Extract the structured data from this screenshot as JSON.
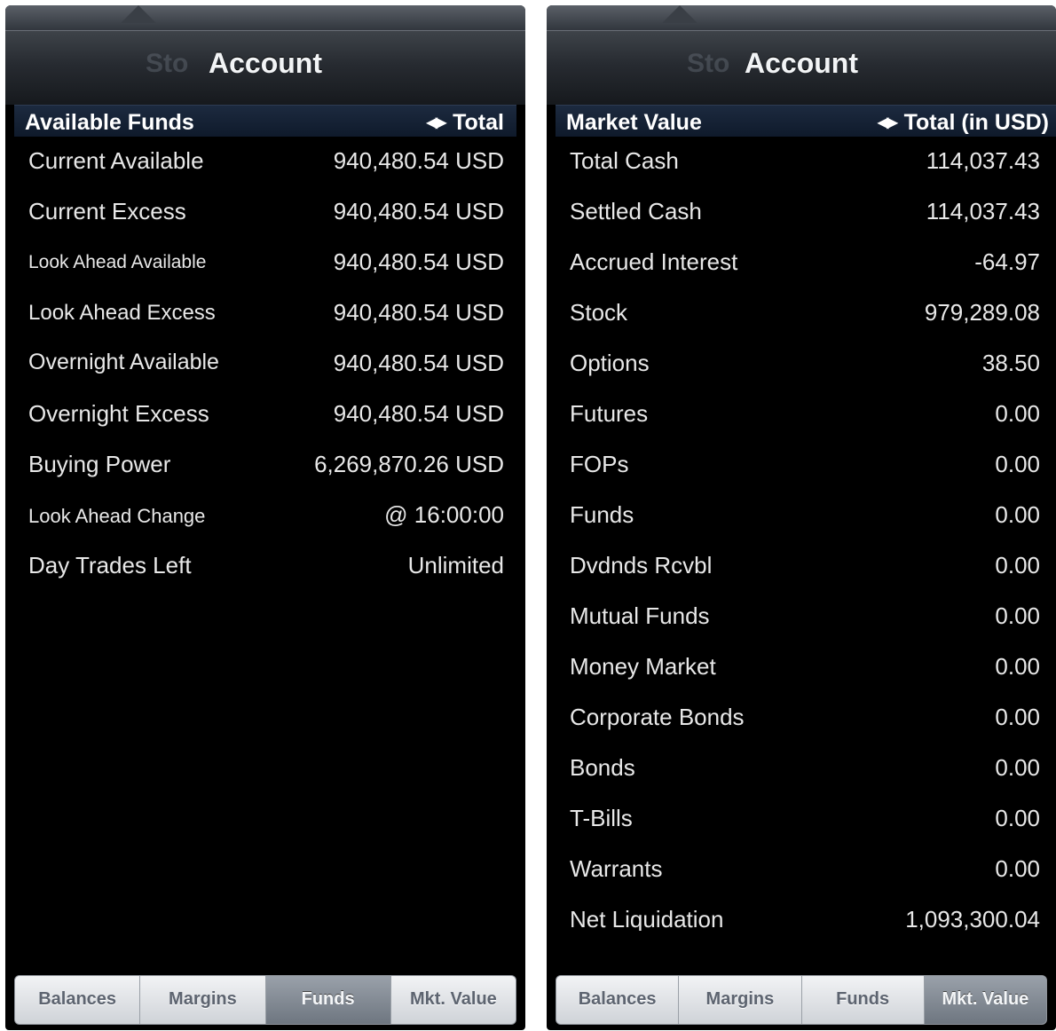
{
  "left": {
    "title": "Account",
    "ghost": "Sto",
    "section": {
      "title": "Available Funds",
      "arrows": "◀▶",
      "right_label": "Total"
    },
    "rows": [
      {
        "label": "Current Available",
        "value": "940,480.54 USD"
      },
      {
        "label": "Current Excess",
        "value": "940,480.54 USD"
      },
      {
        "label": "Look Ahead Available",
        "value": "940,480.54 USD"
      },
      {
        "label": "Look Ahead Excess",
        "value": "940,480.54 USD"
      },
      {
        "label": "Overnight Available",
        "value": "940,480.54 USD"
      },
      {
        "label": "Overnight Excess",
        "value": "940,480.54 USD"
      },
      {
        "label": "Buying Power",
        "value": "6,269,870.26 USD"
      },
      {
        "label": "Look Ahead Change",
        "value": "@ 16:00:00"
      },
      {
        "label": "Day Trades Left",
        "value": "Unlimited"
      }
    ],
    "tabs": [
      "Balances",
      "Margins",
      "Funds",
      "Mkt. Value"
    ],
    "active_tab": "Funds"
  },
  "right": {
    "title": "Account",
    "ghost": "Sto",
    "section": {
      "title": "Market Value",
      "arrows": "◀▶",
      "right_label": "Total (in USD)"
    },
    "rows": [
      {
        "label": "Total Cash",
        "value": "114,037.43"
      },
      {
        "label": "Settled Cash",
        "value": "114,037.43"
      },
      {
        "label": "Accrued Interest",
        "value": "-64.97"
      },
      {
        "label": "Stock",
        "value": "979,289.08"
      },
      {
        "label": "Options",
        "value": "38.50"
      },
      {
        "label": "Futures",
        "value": "0.00"
      },
      {
        "label": "FOPs",
        "value": "0.00"
      },
      {
        "label": "Funds",
        "value": "0.00"
      },
      {
        "label": "Dvdnds Rcvbl",
        "value": "0.00"
      },
      {
        "label": "Mutual Funds",
        "value": "0.00"
      },
      {
        "label": "Money Market",
        "value": "0.00"
      },
      {
        "label": "Corporate Bonds",
        "value": "0.00"
      },
      {
        "label": "Bonds",
        "value": "0.00"
      },
      {
        "label": "T-Bills",
        "value": "0.00"
      },
      {
        "label": "Warrants",
        "value": "0.00"
      },
      {
        "label": "Net Liquidation",
        "value": "1,093,300.04"
      }
    ],
    "tabs": [
      "Balances",
      "Margins",
      "Funds",
      "Mkt. Value"
    ],
    "active_tab": "Mkt. Value"
  }
}
